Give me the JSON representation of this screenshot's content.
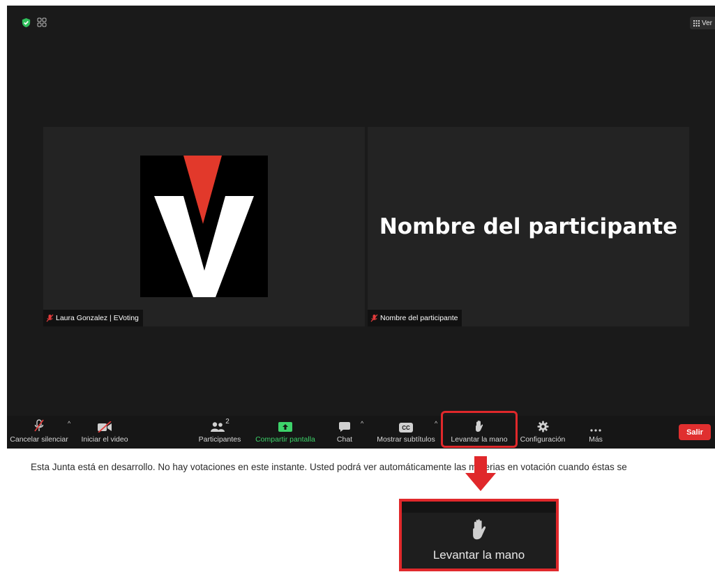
{
  "window": {
    "view_label": "Ver"
  },
  "participants": [
    {
      "name_tag": "Laura Gonzalez | EVoting"
    },
    {
      "name_tag": "Nombre del participante",
      "display_name": "Nombre del participante"
    }
  ],
  "toolbar": {
    "mute_label": "Cancelar silenciar",
    "video_label": "Iniciar el video",
    "participants_label": "Participantes",
    "participants_count": "2",
    "share_label": "Compartir pantalla",
    "chat_label": "Chat",
    "cc_badge": "CC",
    "subtitles_label": "Mostrar subtítulos",
    "raise_hand_label": "Levantar la mano",
    "settings_label": "Configuración",
    "more_label": "Más",
    "leave_label": "Salir"
  },
  "notice": "Esta Junta está en desarrollo. No hay votaciones en este instante. Usted podrá ver automáticamente las materias en votación cuando éstas se",
  "callout": {
    "label": "Levantar la mano"
  },
  "colors": {
    "accent_red": "#e0282b",
    "share_green": "#3dd26a",
    "shield_green": "#2fbf5b",
    "logo_red": "#e2392b"
  }
}
